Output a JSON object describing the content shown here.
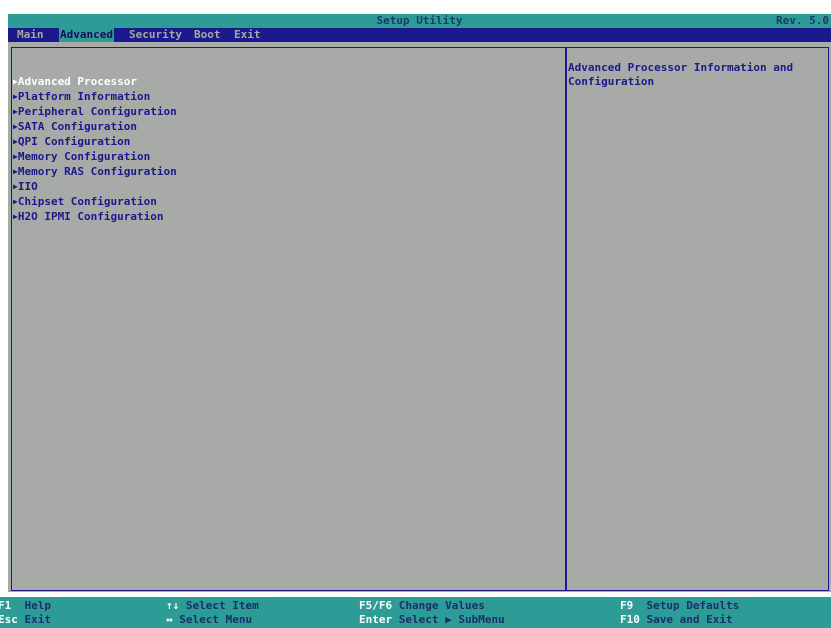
{
  "title": "Setup Utility",
  "revision": "Rev. 5.0",
  "tabs": [
    {
      "label": "Main"
    },
    {
      "label": "Advanced"
    },
    {
      "label": "Security"
    },
    {
      "label": "Boot"
    },
    {
      "label": "Exit"
    }
  ],
  "active_tab": "Advanced",
  "menu_items": [
    {
      "arrow": "▶",
      "label": "Advanced Processor"
    },
    {
      "arrow": "▶",
      "label": "Platform Information"
    },
    {
      "arrow": "▶",
      "label": "Peripheral Configuration"
    },
    {
      "arrow": "▶",
      "label": "SATA Configuration"
    },
    {
      "arrow": "▶",
      "label": "QPI Configuration"
    },
    {
      "arrow": "▶",
      "label": "Memory Configuration"
    },
    {
      "arrow": "▶",
      "label": "Memory RAS Configuration"
    },
    {
      "arrow": "▶",
      "label": "IIO"
    },
    {
      "arrow": "▶",
      "label": "Chipset Configuration"
    },
    {
      "arrow": "▶",
      "label": "H2O IPMI Configuration"
    }
  ],
  "selected_item": "Advanced Processor",
  "help_text": "Advanced Processor Information and\nConfiguration",
  "footer": {
    "help": {
      "key": "F1",
      "desc": "Help"
    },
    "exit": {
      "key": "Esc",
      "desc": "Exit"
    },
    "select_item": {
      "key": "↑↓",
      "desc": "Select Item"
    },
    "select_menu": {
      "key": "↔",
      "desc": "Select Menu"
    },
    "change_values": {
      "key": "F5/F6",
      "desc": "Change Values"
    },
    "select_submenu": {
      "key": "Enter",
      "desc": "Select ▶ SubMenu"
    },
    "setup_defaults": {
      "key": "F9",
      "desc": "Setup Defaults"
    },
    "save_exit": {
      "key": "F10",
      "desc": "Save and Exit"
    }
  },
  "colors": {
    "title_bar": "#2e9c96",
    "menu_bar": "#1a1a8a",
    "background": "#a8aaa8",
    "item_text": "#1a1a8a",
    "selected_item_text": "#ffffff"
  }
}
